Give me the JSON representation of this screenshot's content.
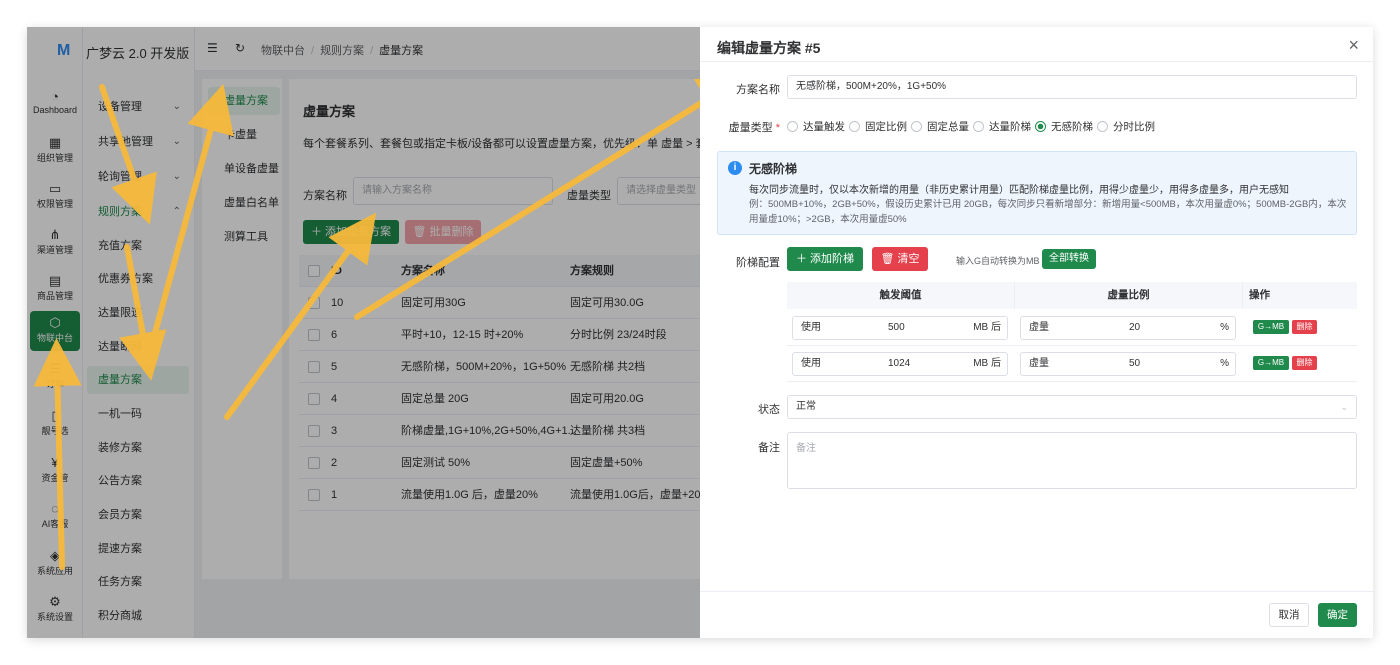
{
  "rail": {
    "logo": "M",
    "items": [
      {
        "label": "Dashboard",
        "icon": "dashboard-icon",
        "glyph": "◔"
      },
      {
        "label": "组织管理",
        "icon": "grid-icon",
        "glyph": "▦"
      },
      {
        "label": "权限管理",
        "icon": "monitor-icon",
        "glyph": "▭"
      },
      {
        "label": "渠道管理",
        "icon": "network-icon",
        "glyph": "⋔"
      },
      {
        "label": "商品管理",
        "icon": "store-icon",
        "glyph": "▤"
      },
      {
        "label": "物联中台",
        "icon": "iot-icon",
        "glyph": "⬡"
      },
      {
        "label": "订单",
        "icon": "list-icon",
        "glyph": "☰"
      },
      {
        "label": "靓号选",
        "icon": "phone-icon",
        "glyph": "▯"
      },
      {
        "label": "资金管",
        "icon": "money-icon",
        "glyph": "¥"
      },
      {
        "label": "AI客服",
        "icon": "ai-icon",
        "glyph": "◌"
      },
      {
        "label": "系统应用",
        "icon": "app-icon",
        "glyph": "◈"
      },
      {
        "label": "系统设置",
        "icon": "settings-icon",
        "glyph": "⚙"
      }
    ]
  },
  "menu": {
    "brand": "广梦云 2.0 开发版",
    "items": [
      {
        "label": "设备管理",
        "chev": "⌄"
      },
      {
        "label": "共享池管理",
        "chev": "⌄"
      },
      {
        "label": "轮询管理",
        "chev": "⌄"
      },
      {
        "label": "规则方案",
        "chev": "⌃"
      },
      {
        "label": "充值方案",
        "chev": ""
      },
      {
        "label": "优惠券方案",
        "chev": ""
      },
      {
        "label": "达量限速",
        "chev": ""
      },
      {
        "label": "达量断网",
        "chev": ""
      },
      {
        "label": "虚量方案",
        "chev": ""
      },
      {
        "label": "一机一码",
        "chev": ""
      },
      {
        "label": "装修方案",
        "chev": ""
      },
      {
        "label": "公告方案",
        "chev": ""
      },
      {
        "label": "会员方案",
        "chev": ""
      },
      {
        "label": "提速方案",
        "chev": ""
      },
      {
        "label": "任务方案",
        "chev": ""
      },
      {
        "label": "积分商城",
        "chev": ""
      }
    ]
  },
  "topbar": {
    "crumbs": [
      "物联中台",
      "规则方案",
      "虚量方案"
    ]
  },
  "submenu": [
    "虚量方案",
    "卡虚量",
    "单设备虚量",
    "虚量白名单",
    "测算工具"
  ],
  "main": {
    "title": "虚量方案",
    "desc": "每个套餐系列、套餐包或指定卡板/设备都可以设置虚量方案，优先级：单 虚量 > 套餐包虚",
    "filter_name_label": "方案名称",
    "filter_name_placeholder": "请输入方案名称",
    "filter_type_label": "虚量类型",
    "filter_type_placeholder": "请选择虚量类型",
    "add_button": "添加虚量方案",
    "batch_delete_button": "批量删除",
    "columns": [
      "ID",
      "方案名称",
      "方案规则"
    ],
    "rows": [
      {
        "id": "10",
        "name": "固定可用30G",
        "rule": "固定可用30.0G"
      },
      {
        "id": "6",
        "name": "平时+10，12-15 时+20%",
        "rule": "分时比例 23/24时段"
      },
      {
        "id": "5",
        "name": "无感阶梯，500M+20%，1G+50%",
        "rule": "无感阶梯 共2档"
      },
      {
        "id": "4",
        "name": "固定总量 20G",
        "rule": "固定可用20.0G"
      },
      {
        "id": "3",
        "name": "阶梯虚量,1G+10%,2G+50%,4G+1...",
        "rule": "达量阶梯 共3档"
      },
      {
        "id": "2",
        "name": "固定测试 50%",
        "rule": "固定虚量+50%"
      },
      {
        "id": "1",
        "name": "流量使用1.0G 后，虚量20%",
        "rule": "流量使用1.0G后，虚量+20%"
      }
    ]
  },
  "drawer": {
    "title": "编辑虚量方案 #5",
    "close": "×",
    "name_label": "方案名称",
    "name_value": "无感阶梯，500M+20%，1G+50%",
    "type_label": "虚量类型",
    "required_mark": "*",
    "type_options": [
      "达量触发",
      "固定比例",
      "固定总量",
      "达量阶梯",
      "无感阶梯",
      "分时比例"
    ],
    "type_selected": 4,
    "alert_title": "无感阶梯",
    "alert_line1": "每次同步流量时，仅以本次新增的用量（非历史累计用量）匹配阶梯虚量比例，用得少虚量少，用得多虚量多，用户无感知",
    "alert_line2": "例：500MB+10%，2GB+50%，假设历史累计已用 20GB，每次同步只看新增部分：新增用量<500MB，本次用量虚0%；500MB-2GB内，本次用量虚10%；>2GB，本次用量虚50%",
    "tier_label": "阶梯配置",
    "add_tier": "添加阶梯",
    "clear": "清空",
    "convert_hint": "输入G自动转换为MB",
    "convert_all": "全部转换",
    "col_threshold": "触发阈值",
    "col_ratio": "虚量比例",
    "col_action": "操作",
    "tiers": [
      {
        "prefix": "使用",
        "value": "500",
        "unit": "MB 后",
        "rprefix": "虚量",
        "ratio": "20",
        "runit": "%"
      },
      {
        "prefix": "使用",
        "value": "1024",
        "unit": "MB 后",
        "rprefix": "虚量",
        "ratio": "50",
        "runit": "%"
      }
    ],
    "row_convert": "G→MB",
    "row_delete": "删除",
    "status_label": "状态",
    "status_value": "正常",
    "remark_label": "备注",
    "remark_placeholder": "备注",
    "cancel": "取消",
    "ok": "确定"
  },
  "colors": {
    "primary": "#1f8a4c",
    "danger": "#e5414d",
    "info": "#2d8cf0",
    "arrow": "#f6b93b"
  }
}
